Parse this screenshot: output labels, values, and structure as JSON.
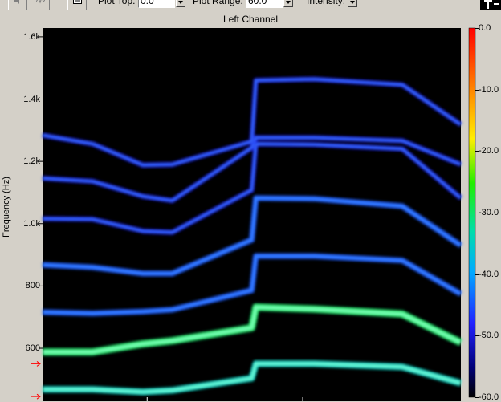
{
  "toolbar": {
    "plot_top_label": "Plot Top:",
    "plot_top_value": "0.0",
    "plot_range_label": "Plot Range:",
    "plot_range_value": "60.0",
    "intensity_label": "Intensity:"
  },
  "colors": {
    "background": "#d4d0c8",
    "plot_background": "#000000",
    "low": "#1c1cf0",
    "mid": "#00e0d0",
    "high": "#18f070"
  },
  "icons": [
    "speaker-icon",
    "waveform-icon",
    "display-options-icon",
    "pin-icon",
    "marker-arrow-icon"
  ],
  "chart_data": {
    "type": "heatmap",
    "title": "Left Channel",
    "ylabel": "Frequency (Hz)",
    "xlabel": "",
    "y_ticks": [
      "1.6k",
      "1.4k",
      "1.2k",
      "1.0k",
      "800",
      "600"
    ],
    "y_tick_values": [
      1600,
      1400,
      1200,
      1000,
      800,
      600
    ],
    "ylim": [
      430,
      1610
    ],
    "xlim": [
      0,
      1
    ],
    "colorbar": {
      "ticks": [
        "0.0",
        "-10.0",
        "-20.0",
        "-30.0",
        "-40.0",
        "-50.0",
        "-60.0"
      ],
      "range_db": [
        -60,
        0
      ]
    },
    "harmonic_markers_hz": [
      550,
      445
    ],
    "harmonics": [
      {
        "harmonic": 1,
        "level_db": -30,
        "x": [
          0,
          0.12,
          0.24,
          0.31,
          0.5,
          0.51,
          0.65,
          0.86,
          1
        ],
        "y": [
          468,
          468,
          460,
          465,
          504,
          550,
          550,
          540,
          488
        ]
      },
      {
        "harmonic": 2,
        "level_db": -25,
        "x": [
          0,
          0.12,
          0.24,
          0.31,
          0.5,
          0.51,
          0.65,
          0.86,
          1
        ],
        "y": [
          588,
          588,
          614,
          624,
          666,
          732,
          726,
          710,
          618
        ]
      },
      {
        "harmonic": 3,
        "level_db": -37,
        "x": [
          0,
          0.12,
          0.24,
          0.31,
          0.5,
          0.51,
          0.65,
          0.86,
          1
        ],
        "y": [
          716,
          712,
          718,
          724,
          786,
          896,
          896,
          882,
          774
        ]
      },
      {
        "harmonic": 4,
        "level_db": -44,
        "x": [
          0,
          0.12,
          0.24,
          0.31,
          0.5,
          0.51,
          0.65,
          0.86,
          1
        ],
        "y": [
          868,
          860,
          840,
          840,
          948,
          1082,
          1080,
          1056,
          930
        ]
      },
      {
        "harmonic": 5,
        "level_db": -46,
        "x": [
          0,
          0.12,
          0.24,
          0.31,
          0.5,
          0.51,
          0.65,
          0.86,
          1
        ],
        "y": [
          1016,
          1014,
          976,
          972,
          1108,
          1256,
          1254,
          1240,
          1082
        ]
      },
      {
        "harmonic": 6,
        "level_db": -48,
        "x": [
          0,
          0.12,
          0.24,
          0.31,
          0.5,
          0.51,
          0.65,
          0.86,
          1
        ],
        "y": [
          1146,
          1136,
          1088,
          1074,
          1244,
          1276,
          1276,
          1266,
          1190
        ]
      },
      {
        "harmonic": 7,
        "level_db": -52,
        "x": [
          0,
          0.12,
          0.24,
          0.31,
          0.5,
          0.51,
          0.65,
          0.86,
          1
        ],
        "y": [
          1284,
          1256,
          1188,
          1190,
          1264,
          1460,
          1464,
          1446,
          1318
        ]
      }
    ]
  }
}
